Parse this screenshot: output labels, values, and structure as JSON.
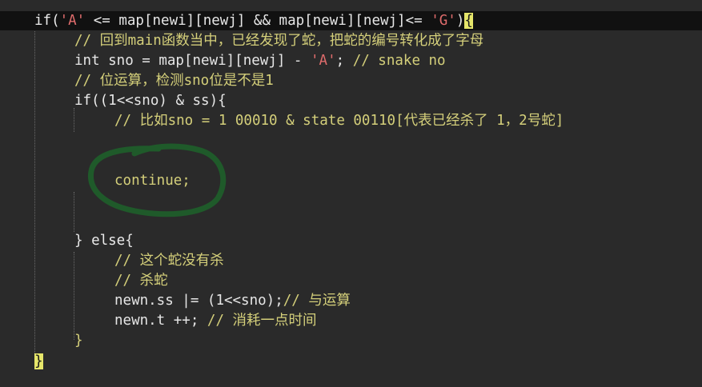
{
  "editor": {
    "lines": [
      {
        "id": "line-if-condition",
        "tokens": [
          {
            "t": "if(",
            "c": "kw"
          },
          {
            "t": "'A'",
            "c": "str"
          },
          {
            "t": " <= map[newi][newj] && map[newi][newj]<= ",
            "c": "op"
          },
          {
            "t": "'G'",
            "c": "str"
          },
          {
            "t": ")",
            "c": "op"
          },
          {
            "t": "{",
            "c": "brace-hl"
          }
        ]
      },
      {
        "id": "line-comment-back-to-main",
        "tokens": [
          {
            "t": "// 回到main函数当中，已经发现了蛇，把蛇的编号转化成了字母",
            "c": "cmt"
          }
        ]
      },
      {
        "id": "line-int-sno",
        "tokens": [
          {
            "t": "int sno = map[newi][newj] - ",
            "c": "op"
          },
          {
            "t": "'A'",
            "c": "str"
          },
          {
            "t": "; ",
            "c": "op"
          },
          {
            "t": "// snake no",
            "c": "cmt"
          }
        ]
      },
      {
        "id": "line-comment-bitwise",
        "tokens": [
          {
            "t": "// 位运算，检测sno位是不是1",
            "c": "cmt"
          }
        ]
      },
      {
        "id": "line-if-bitcheck",
        "tokens": [
          {
            "t": "if((",
            "c": "kw"
          },
          {
            "t": "1",
            "c": "num"
          },
          {
            "t": "<<sno) & ss){",
            "c": "op"
          }
        ]
      },
      {
        "id": "line-comment-example",
        "tokens": [
          {
            "t": "// 比如sno = 1 00010 & state 00110[代表已经杀了 1，2号蛇]",
            "c": "cmt"
          }
        ]
      },
      {
        "id": "line-blank-1",
        "tokens": []
      },
      {
        "id": "line-continue",
        "tokens": [
          {
            "t": "continue;",
            "c": "cmt"
          }
        ]
      },
      {
        "id": "line-blank-2",
        "tokens": []
      },
      {
        "id": "line-else",
        "tokens": [
          {
            "t": "} ",
            "c": "op"
          },
          {
            "t": "else",
            "c": "kw"
          },
          {
            "t": "{",
            "c": "op"
          }
        ]
      },
      {
        "id": "line-comment-not-killed",
        "tokens": [
          {
            "t": "// 这个蛇没有杀",
            "c": "cmt"
          }
        ]
      },
      {
        "id": "line-comment-kill",
        "tokens": [
          {
            "t": "// 杀蛇",
            "c": "cmt"
          }
        ]
      },
      {
        "id": "line-newn-ss",
        "tokens": [
          {
            "t": "newn.ss |= (",
            "c": "op"
          },
          {
            "t": "1",
            "c": "num"
          },
          {
            "t": "<<sno);",
            "c": "op"
          },
          {
            "t": "// 与运算",
            "c": "cmt"
          }
        ]
      },
      {
        "id": "line-newn-t",
        "tokens": [
          {
            "t": "newn.t ++; ",
            "c": "op"
          },
          {
            "t": "// 消耗一点时间",
            "c": "cmt"
          }
        ]
      },
      {
        "id": "line-close-else",
        "tokens": [
          {
            "t": "}",
            "c": "cmt"
          }
        ]
      },
      {
        "id": "line-close-if",
        "tokens": [
          {
            "t": "}",
            "c": "brace-hl"
          }
        ]
      }
    ]
  },
  "annotation": {
    "type": "hand-drawn-circle",
    "color": "#1f5a2a",
    "target": "continue;"
  }
}
